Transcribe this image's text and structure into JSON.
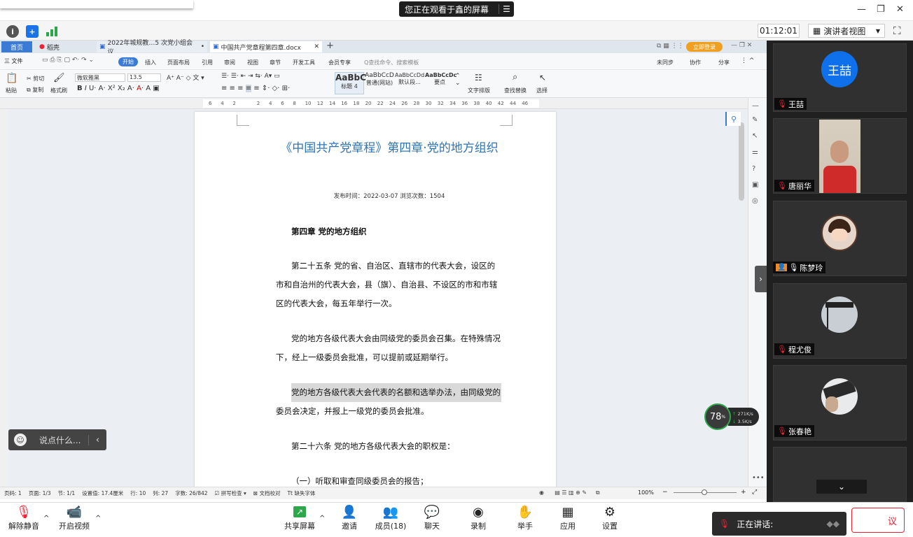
{
  "share": {
    "banner": "您正在观看于鑫的屏幕",
    "menu_icon": "menu-icon"
  },
  "meeting": {
    "timer": "01:12:01",
    "view_label": "演讲者视图"
  },
  "wps": {
    "tabs": [
      {
        "label": "首页"
      },
      {
        "label": "稻壳"
      },
      {
        "label": "2022年城规教…5 次党小组会议"
      },
      {
        "label": "中国共产党章程第四章.docx"
      }
    ],
    "login_label": "立即登录",
    "menu": [
      "三 文件",
      "开始",
      "插入",
      "页面布局",
      "引用",
      "审阅",
      "视图",
      "章节",
      "开发工具",
      "会员专享"
    ],
    "search_placeholder": "Q查找命令、搜索模板",
    "right_actions": [
      "未同步",
      "协作",
      "分享"
    ],
    "ribbon": {
      "paste": "粘贴",
      "cut": "剪切",
      "copy": "复制",
      "format_painter": "格式刷",
      "font_name": "微软雅黑",
      "font_size": "13.5",
      "styles": [
        {
          "sample": "AaBbC",
          "name": "标题 4"
        },
        {
          "sample": "AaBbCcD",
          "name": "普通(网站)"
        },
        {
          "sample": "AaBbCcDd",
          "name": "默认段..."
        },
        {
          "sample": "AaBbCcDc",
          "name": "要点"
        }
      ],
      "text_layout": "文字排版",
      "find_replace": "查找替换",
      "select": "选择"
    },
    "ruler_ticks": [
      "6",
      "4",
      "2",
      "",
      "2",
      "4",
      "6",
      "8",
      "10",
      "12",
      "14",
      "16",
      "18",
      "20",
      "22",
      "24",
      "26",
      "28",
      "30",
      "32",
      "34",
      "36",
      "38",
      "40",
      "42",
      "44",
      "46"
    ]
  },
  "document": {
    "title": "《中国共产党章程》第四章·党的地方组织",
    "meta": "发布时间：2022-03-07 浏览次数：1504",
    "chapter": "第四章 党的地方组织",
    "paragraphs": [
      "第二十五条 党的省、自治区、直辖市的代表大会，设区的市和自治州的代表大会，县（旗）、自治县、不设区的市和市辖区的代表大会，每五年举行一次。",
      "党的地方各级代表大会由同级党的委员会召集。在特殊情况下，经上一级委员会批准，可以提前或延期举行。",
      "党的地方各级代表大会代表的名额和选举办法，由同级党的委员会决定，并报上一级党的委员会批准。",
      "第二十六条 党的地方各级代表大会的职权是：",
      "（一）听取和审查同级委员会的报告；"
    ]
  },
  "status": {
    "page": "页码: 1",
    "pages": "页面: 1/3",
    "section": "节: 1/1",
    "setting": "设置值: 17.4厘米",
    "row": "行: 10",
    "col": "列: 27",
    "words": "字数: 26/842",
    "spell": "拼写检查",
    "proofread": "文档校对",
    "font_missing": "缺失字体",
    "zoom": "100%"
  },
  "chat_float": {
    "placeholder": "说点什么..."
  },
  "network": {
    "percent": "78",
    "up": "271K/s",
    "down": "3.5K/s"
  },
  "participants": [
    {
      "name": "王喆",
      "avatar_text": "王喆",
      "avatar_color": "#0e71eb"
    },
    {
      "name": "唐丽华"
    },
    {
      "name": "陈梦玲"
    },
    {
      "name": "程尤俊"
    },
    {
      "name": "张春艳"
    }
  ],
  "toolbar": {
    "unmute": "解除静音",
    "video": "开启视频",
    "share": "共享屏幕",
    "invite": "邀请",
    "members": "成员(18)",
    "chat": "聊天",
    "record": "录制",
    "raise_hand": "举手",
    "apps": "应用",
    "settings": "设置"
  },
  "speaking": {
    "label": "正在讲话:"
  },
  "leave_partial": "议",
  "colors": {
    "accent": "#0e71eb",
    "doc_title": "#2e74b5",
    "gallery_bg": "#202020",
    "highlight": "#d9d9d9"
  }
}
